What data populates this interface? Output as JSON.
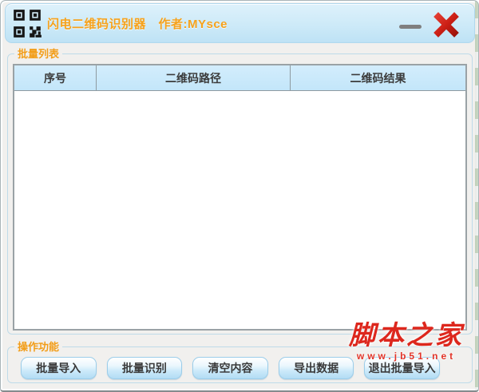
{
  "titlebar": {
    "title": "闪电二维码识别器　作者:MYsce",
    "title_color": "#f6a21c",
    "icons": {
      "app": "qr-code-icon",
      "minimize": "minimize-dash-icon",
      "close": "close-x-icon"
    }
  },
  "groups": {
    "list": {
      "label": "批量列表"
    },
    "ops": {
      "label": "操作功能"
    }
  },
  "table": {
    "columns": [
      {
        "label": "序号"
      },
      {
        "label": "二维码路径"
      },
      {
        "label": "二维码结果"
      }
    ],
    "rows": []
  },
  "buttons": [
    {
      "label": "批量导入"
    },
    {
      "label": "批量识别"
    },
    {
      "label": "清空内容"
    },
    {
      "label": "导出数据"
    },
    {
      "label": "退出批量导入"
    }
  ],
  "watermark": {
    "title": "脚本之家",
    "url": "www.jb51.net",
    "color": "#dd271d"
  },
  "colors": {
    "titlebar_blue": "#cdeaf8",
    "table_header_blue": "#c3e6fa",
    "label_orange": "#f29d18",
    "close_red": "#cc1f15",
    "window_bg": "#f1f0ee"
  }
}
